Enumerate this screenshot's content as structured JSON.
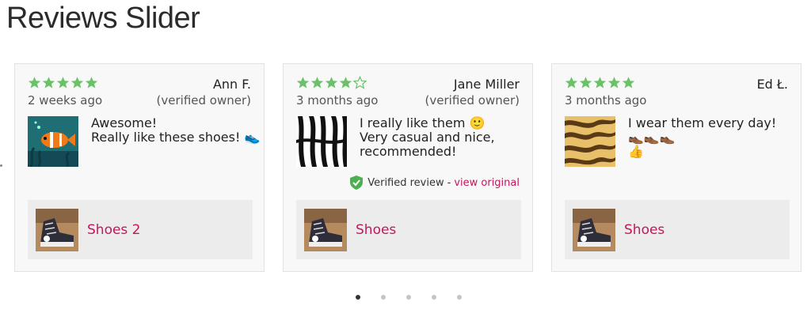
{
  "page": {
    "title": "Reviews Slider"
  },
  "colors": {
    "star": "#6cc06a",
    "link": "#c2185b",
    "shield": "#4caf50"
  },
  "reviews": [
    {
      "rating": 5,
      "author": "Ann F.",
      "date": "2 weeks ago",
      "owner_label": "(verified owner)",
      "image_icon": "clownfish-image",
      "text_lines": [
        "Awesome!",
        "Really like these shoes! 👟"
      ],
      "product": {
        "name": "Shoes 2",
        "image_icon": "sneaker-image"
      }
    },
    {
      "rating": 4,
      "author": "Jane Miller",
      "date": "3 months ago",
      "owner_label": "(verified owner)",
      "image_icon": "zebra-pattern-image",
      "text_lines": [
        "I really like them 🙂",
        "Very casual and nice,",
        "recommended!"
      ],
      "verified_review": {
        "label": "Verified review",
        "separator": "-",
        "link": "view original"
      },
      "product": {
        "name": "Shoes",
        "image_icon": "sneaker-image"
      }
    },
    {
      "rating": 5,
      "author": "Ed Ł.",
      "date": "3 months ago",
      "image_icon": "tiger-pattern-image",
      "text_lines": [
        "I wear them every day!",
        "👞👞👞",
        "👍"
      ],
      "product": {
        "name": "Shoes",
        "image_icon": "sneaker-image"
      }
    }
  ],
  "pagination": {
    "total": 5,
    "active": 0
  }
}
